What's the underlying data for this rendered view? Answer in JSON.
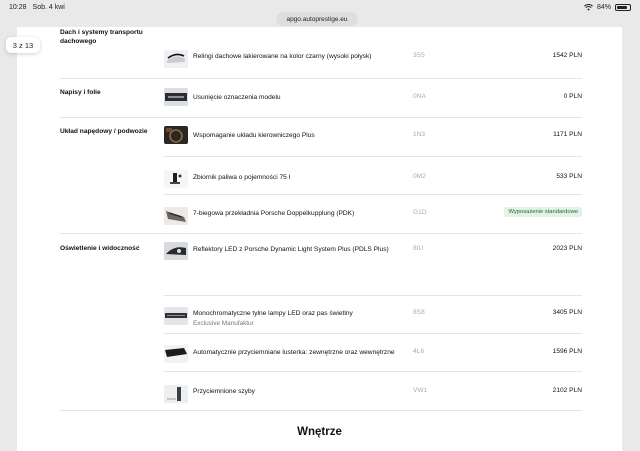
{
  "status_bar": {
    "time": "10:28",
    "date": "Sob. 4 kwi",
    "battery": "84%",
    "battery_level": 0.84
  },
  "browser": {
    "url": "apgo.autoprestige.eu"
  },
  "page_counter": "3 z 13",
  "rows": [
    {
      "category": "Dach i systemy transportu dachowego",
      "icon": "roof-rails-icon",
      "name": "Relingi dachowe lakierowane na kolor czarny (wysoki połysk)",
      "code": "3S5",
      "price": "1542 PLN"
    },
    {
      "category": "Napisy i folie",
      "icon": "rear-badge-icon",
      "name": "Usunięcie oznaczenia modelu",
      "code": "0NA",
      "price": "0 PLN"
    },
    {
      "category": "Układ napędowy / podwozie",
      "icon": "steering-icon",
      "name": "Wspomaganie układu kierowniczego Plus",
      "code": "1N3",
      "price": "1171 PLN"
    },
    {
      "category": "",
      "icon": "fuel-tank-icon",
      "name": "Zbiornik paliwa o pojemności 75 l",
      "code": "0M2",
      "price": "533 PLN"
    },
    {
      "category": "",
      "icon": "gearbox-icon",
      "name": "7-biegowa przekładnia Porsche Doppelkupplung (PDK)",
      "code": "G1D",
      "badge": "Wyposażenie standardowe"
    },
    {
      "category": "Oświetlenie i widoczność",
      "icon": "headlight-icon",
      "name": "Reflektory LED z Porsche Dynamic Light System Plus (PDLS Plus)",
      "code": "8IU",
      "price": "2023 PLN"
    },
    {
      "category": "",
      "icon": "taillight-icon",
      "name": "Monochromatyczne tylne lampy LED oraz pas świetlny",
      "sub": "Exclusive Manufaktur",
      "code": "8S8",
      "price": "3405 PLN"
    },
    {
      "category": "",
      "icon": "mirror-icon",
      "name": "Automatycznie przyciemniane lusterka: zewnętrzne oraz wewnętrzne",
      "code": "4L6",
      "price": "1596 PLN"
    },
    {
      "category": "",
      "icon": "tinted-glass-icon",
      "name": "Przyciemnione szyby",
      "code": "VW1",
      "price": "2102 PLN"
    }
  ],
  "next_section": "Wnętrze",
  "colors": {
    "badge_bg": "#e3f2e6",
    "badge_text": "#1d6b2e",
    "code": "#aaaaaa"
  }
}
